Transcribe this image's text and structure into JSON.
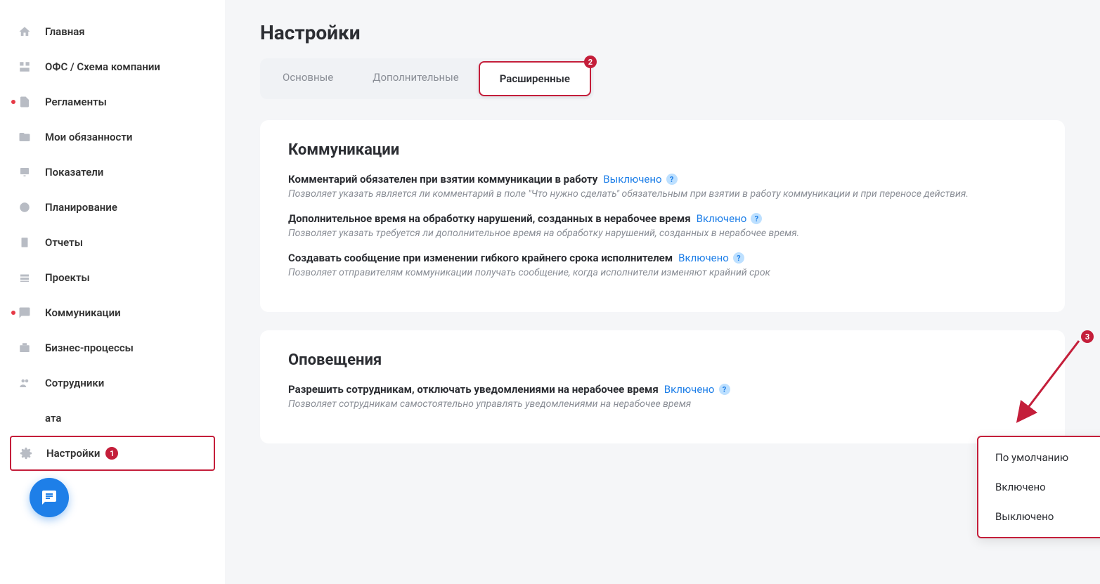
{
  "sidebar": {
    "items": [
      {
        "label": "Главная",
        "icon": "home"
      },
      {
        "label": "ОФС / Схема компании",
        "icon": "org"
      },
      {
        "label": "Регламенты",
        "icon": "doc",
        "hasRedDot": true
      },
      {
        "label": "Мои обязанности",
        "icon": "folder"
      },
      {
        "label": "Показатели",
        "icon": "chart"
      },
      {
        "label": "Планирование",
        "icon": "clock"
      },
      {
        "label": "Отчеты",
        "icon": "clipboard"
      },
      {
        "label": "Проекты",
        "icon": "stack"
      },
      {
        "label": "Коммуникации",
        "icon": "chat",
        "hasRedDot": true
      },
      {
        "label": "Бизнес-процессы",
        "icon": "briefcase"
      },
      {
        "label": "Сотрудники",
        "icon": "users"
      },
      {
        "label": "ата",
        "icon": "blank"
      },
      {
        "label": "Настройки",
        "icon": "gear",
        "highlighted": true,
        "badge": "1"
      }
    ]
  },
  "page": {
    "title": "Настройки"
  },
  "tabs": [
    {
      "label": "Основные",
      "active": false
    },
    {
      "label": "Дополнительные",
      "active": false
    },
    {
      "label": "Расширенные",
      "active": true,
      "badge": "2"
    }
  ],
  "sections": {
    "communications": {
      "title": "Коммуникации",
      "settings": [
        {
          "label": "Комментарий обязателен при взятии коммуникации в работу",
          "value": "Выключено",
          "description": "Позволяет указать является ли комментарий в поле \"Что нужно сделать\" обязательным при взятии в работу коммуникации и при переносе действия."
        },
        {
          "label": "Дополнительное время на обработку нарушений, созданных в нерабочее время",
          "value": "Включено",
          "description": "Позволяет указать требуется ли дополнительное время на обработку нарушений, созданных в нерабочее время."
        },
        {
          "label": "Создавать сообщение при изменении гибкого крайнего срока исполнителем",
          "value": "Включено",
          "description": "Позволяет отправителям коммуникации получать сообщение, когда исполнители изменяют крайний срок"
        }
      ]
    },
    "notifications": {
      "title": "Оповещения",
      "settings": [
        {
          "label": "Разрешить сотрудникам, отключать уведомлениями на нерабочее время",
          "value": "Включено",
          "description": "Позволяет сотрудникам самостоятельно управлять уведомлениями на нерабочее время"
        }
      ]
    }
  },
  "dropdown": {
    "options": [
      "По умолчанию",
      "Включено",
      "Выключено"
    ],
    "badge": "3"
  }
}
